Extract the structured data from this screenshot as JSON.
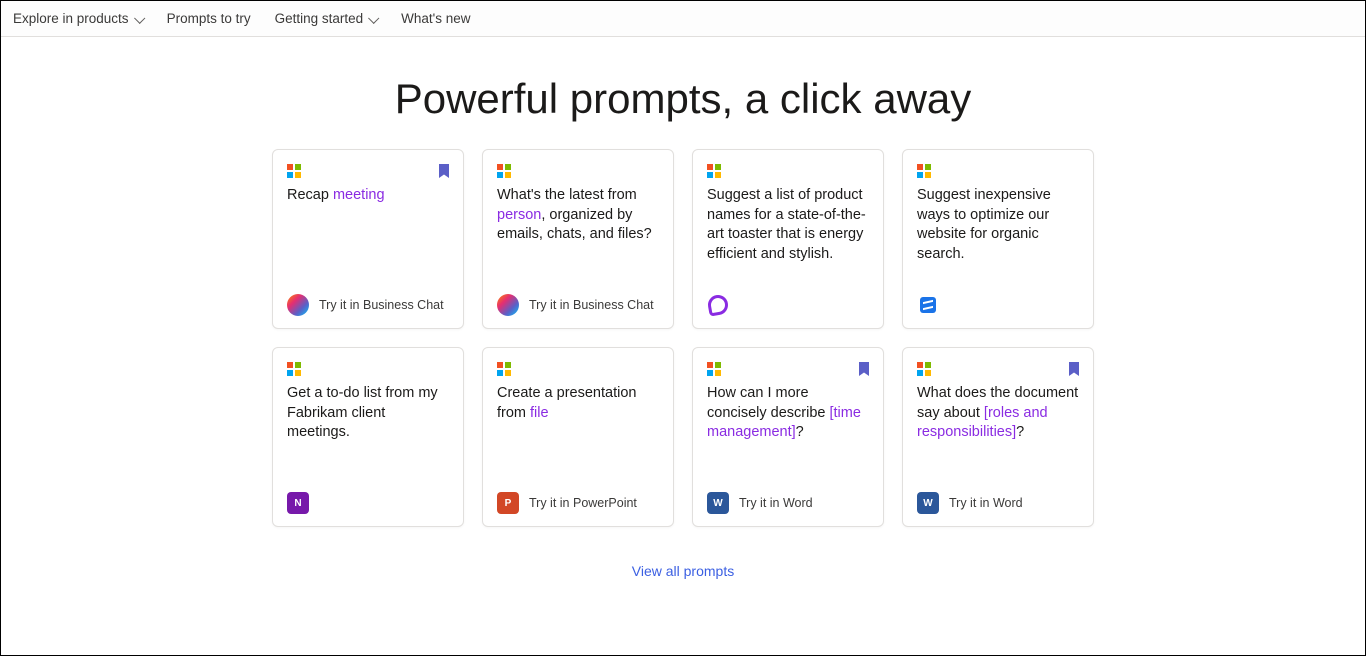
{
  "nav": {
    "explore": "Explore in products",
    "prompts": "Prompts to try",
    "getting_started": "Getting started",
    "whats_new": "What's new"
  },
  "hero": "Powerful prompts, a click away",
  "cards": [
    {
      "bookmark": true,
      "text_pre": "Recap ",
      "highlight": "meeting",
      "text_post": "",
      "app": "copilot",
      "foot": "Try it in Business Chat"
    },
    {
      "bookmark": false,
      "text_pre": "What's the latest from ",
      "highlight": "person",
      "text_post": ", organized by emails, chats, and files?",
      "app": "copilot",
      "foot": "Try it in Business Chat"
    },
    {
      "bookmark": false,
      "text_pre": "Suggest a list of product names for a state-of-the-art toaster that is energy efficient and stylish.",
      "highlight": "",
      "text_post": "",
      "app": "loop",
      "foot": ""
    },
    {
      "bookmark": false,
      "text_pre": "Suggest inexpensive ways to optimize our website for organic search.",
      "highlight": "",
      "text_post": "",
      "app": "whiteboard",
      "foot": ""
    },
    {
      "bookmark": false,
      "text_pre": "Get a to-do list from my Fabrikam client meetings.",
      "highlight": "",
      "text_post": "",
      "app": "onenote",
      "foot": ""
    },
    {
      "bookmark": false,
      "text_pre": "Create a presentation from ",
      "highlight": "file",
      "text_post": "",
      "app": "powerpoint",
      "foot": "Try it in PowerPoint"
    },
    {
      "bookmark": true,
      "text_pre": "How can I more concisely describe ",
      "bracket": "[time management]",
      "text_post": "?",
      "app": "word",
      "foot": "Try it in Word"
    },
    {
      "bookmark": true,
      "text_pre": "What does the document say about ",
      "bracket": "[roles and responsibilities]",
      "text_post": "?",
      "app": "word",
      "foot": "Try it in Word"
    }
  ],
  "view_all": "View all prompts"
}
